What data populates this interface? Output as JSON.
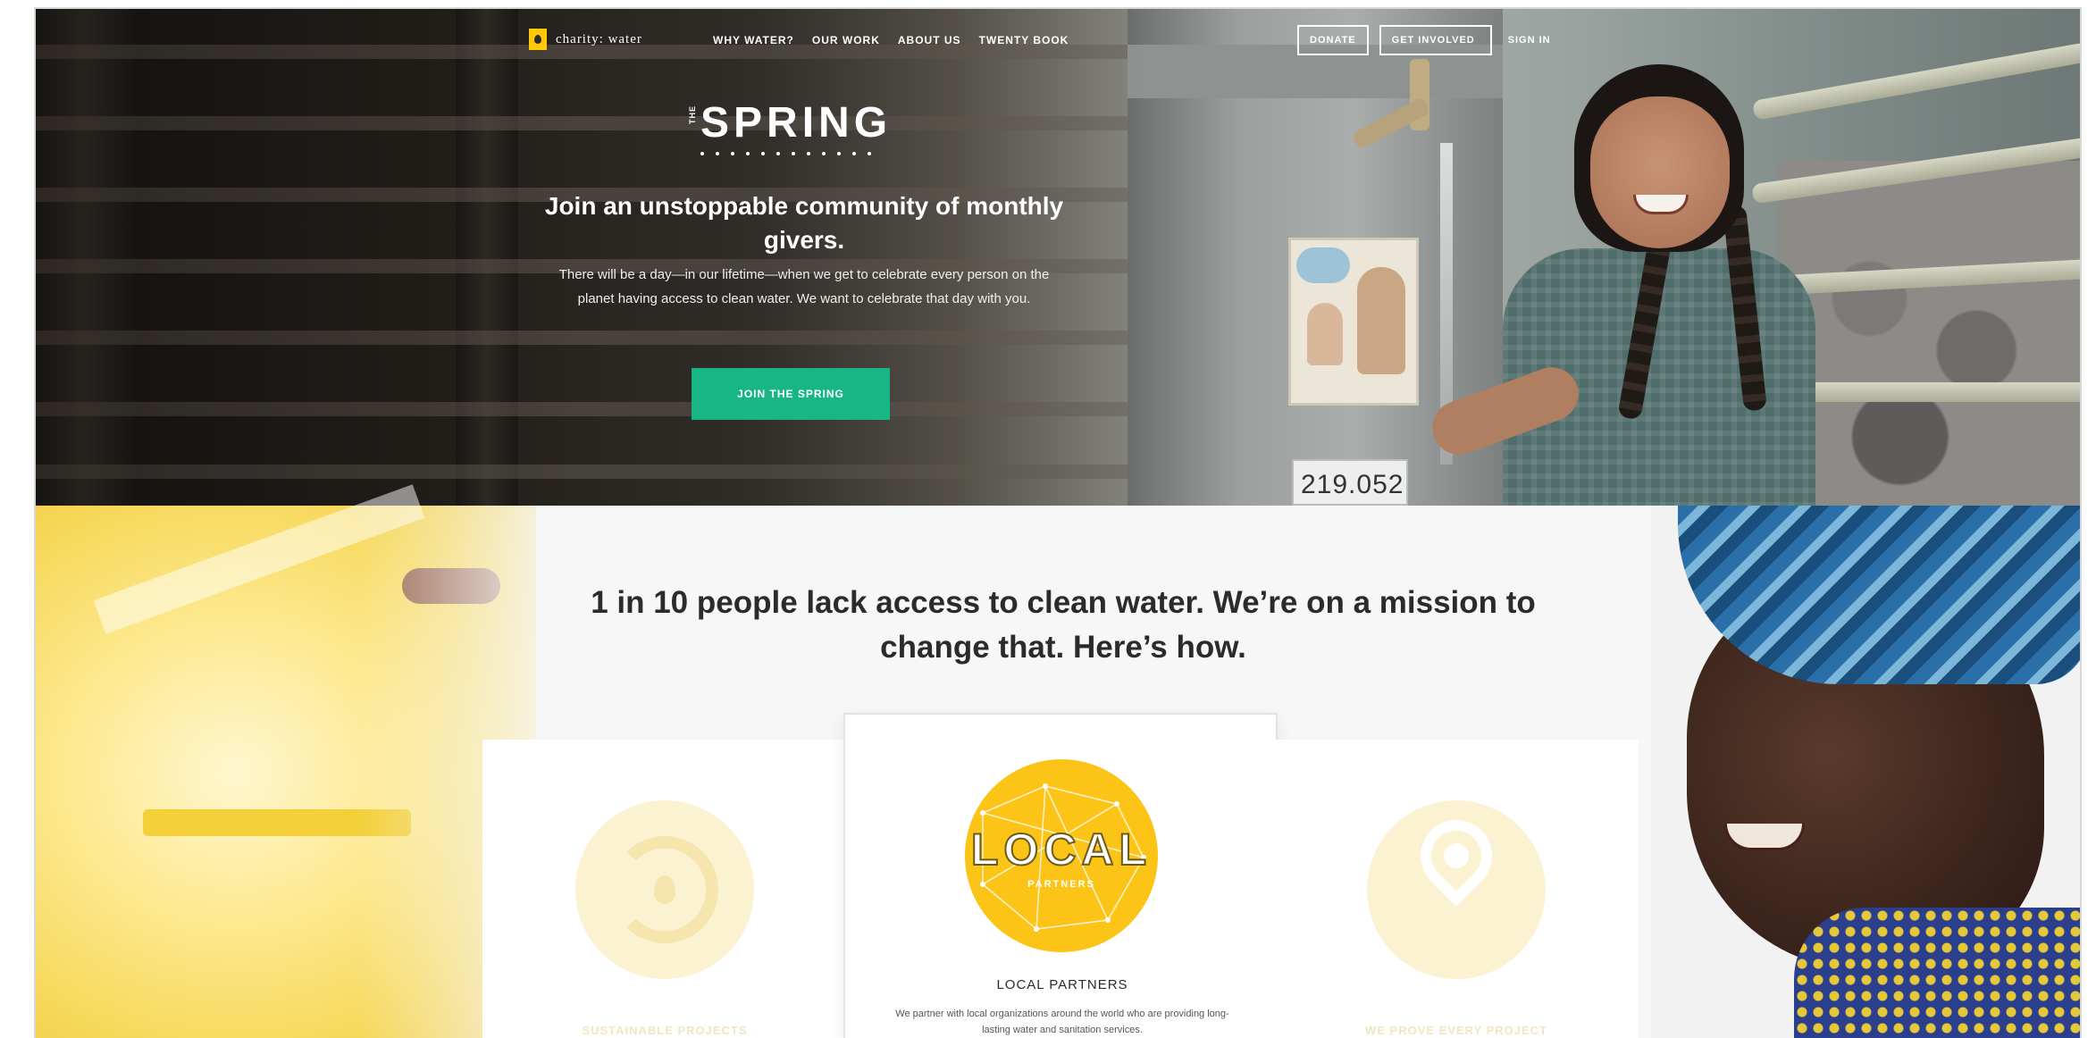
{
  "nav": {
    "logo_text": "charity: water",
    "links": [
      "WHY WATER?",
      "OUR WORK",
      "ABOUT US",
      "TWENTY BOOK"
    ],
    "donate": "DONATE",
    "get_involved": "GET INVOLVED",
    "sign_in": "SIGN IN"
  },
  "hero": {
    "brand_prefix": "THE",
    "brand_word": "SPRING",
    "title": "Join an unstoppable community of monthly givers.",
    "body": "There will be a day—in our lifetime—when we get to celebrate every person on the planet having access to clean water. We want to celebrate that day with you.",
    "cta": "JOIN THE SPRING",
    "plate_number": "219.052"
  },
  "mission": {
    "headline": "1 in 10 people lack access to clean water. We’re on a mission to change that. Here’s how.",
    "cards": [
      {
        "label": "SUSTAINABLE PROJECTS",
        "icon": "recycle-icon"
      },
      {
        "label": "LOCAL PARTNERS",
        "badge_word": "LOCAL",
        "badge_sub": "PARTNERS",
        "body": "We partner with local organizations around the world who are providing long-lasting water and sanitation services.",
        "icon": "local-partners-badge"
      },
      {
        "label": "WE PROVE EVERY PROJECT",
        "icon": "map-pin-icon"
      }
    ]
  },
  "colors": {
    "accent_green": "#19b685",
    "brand_yellow": "#fbc417",
    "text_dark": "#2b2b2b"
  }
}
